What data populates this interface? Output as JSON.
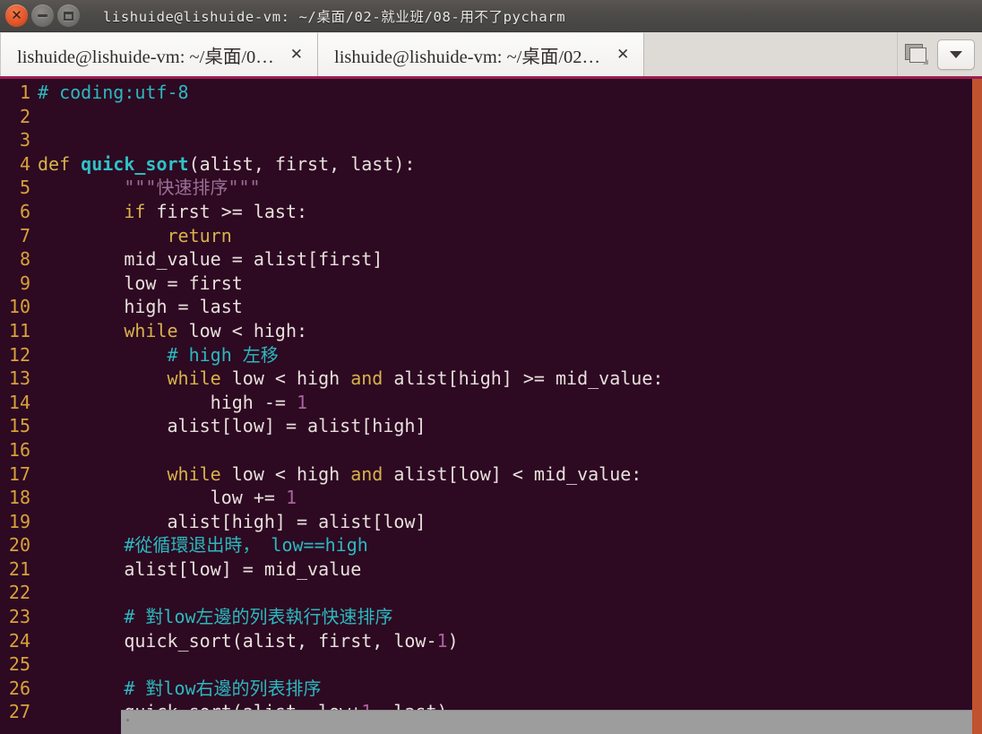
{
  "window": {
    "title": "lishuide@lishuide-vm: ~/桌面/02-就业班/08-用不了pycharm",
    "buttons": {
      "close": "×",
      "minimize": "−",
      "maximize": "□"
    }
  },
  "tabs": [
    {
      "label": "lishuide@lishuide-vm: ~/桌面/0…",
      "close": "✕",
      "active": false
    },
    {
      "label": "lishuide@lishuide-vm: ~/桌面/02…",
      "close": "✕",
      "active": true
    }
  ],
  "tabbar_controls": {
    "new_tab_icon": "new-tab-icon",
    "dropdown_icon": "chevron-down-icon"
  },
  "colors": {
    "terminal_background": "#2d0922",
    "accent_border": "#c0522f",
    "tabbar_underline": "#9c1d52",
    "line_number": "#d7a23a",
    "keyword": "#d8b24a",
    "function": "#2fc2c6",
    "comment": "#2bb9bf",
    "string": "#9c6f95",
    "number": "#a9639f",
    "plain_text": "#e8e0dc"
  },
  "editor": {
    "lines": [
      {
        "n": "1",
        "tokens": [
          {
            "t": "# coding:utf-8",
            "c": "c-com"
          }
        ]
      },
      {
        "n": "2",
        "tokens": []
      },
      {
        "n": "3",
        "tokens": []
      },
      {
        "n": "4",
        "tokens": [
          {
            "t": "def ",
            "c": "c-def"
          },
          {
            "t": "quick_sort",
            "c": "c-fn"
          },
          {
            "t": "(alist, first, last):",
            "c": "c-plain"
          }
        ]
      },
      {
        "n": "5",
        "tokens": [
          {
            "t": "        ",
            "c": "c-plain"
          },
          {
            "t": "\"\"\"快速排序\"\"\"",
            "c": "c-str"
          }
        ]
      },
      {
        "n": "6",
        "tokens": [
          {
            "t": "        ",
            "c": "c-plain"
          },
          {
            "t": "if ",
            "c": "c-def"
          },
          {
            "t": "first >= last:",
            "c": "c-plain"
          }
        ]
      },
      {
        "n": "7",
        "tokens": [
          {
            "t": "            ",
            "c": "c-plain"
          },
          {
            "t": "return",
            "c": "c-def"
          }
        ]
      },
      {
        "n": "8",
        "tokens": [
          {
            "t": "        mid_value = alist[first]",
            "c": "c-plain"
          }
        ]
      },
      {
        "n": "9",
        "tokens": [
          {
            "t": "        low = first",
            "c": "c-plain"
          }
        ]
      },
      {
        "n": "10",
        "tokens": [
          {
            "t": "        high = last",
            "c": "c-plain"
          }
        ]
      },
      {
        "n": "11",
        "tokens": [
          {
            "t": "        ",
            "c": "c-plain"
          },
          {
            "t": "while ",
            "c": "c-def"
          },
          {
            "t": "low < high:",
            "c": "c-plain"
          }
        ]
      },
      {
        "n": "12",
        "tokens": [
          {
            "t": "            ",
            "c": "c-plain"
          },
          {
            "t": "# high 左移",
            "c": "c-com"
          }
        ]
      },
      {
        "n": "13",
        "tokens": [
          {
            "t": "            ",
            "c": "c-plain"
          },
          {
            "t": "while ",
            "c": "c-def"
          },
          {
            "t": "low < high ",
            "c": "c-plain"
          },
          {
            "t": "and ",
            "c": "c-def"
          },
          {
            "t": "alist[high] >= mid_value:",
            "c": "c-plain"
          }
        ]
      },
      {
        "n": "14",
        "tokens": [
          {
            "t": "                high -= ",
            "c": "c-plain"
          },
          {
            "t": "1",
            "c": "c-num"
          }
        ]
      },
      {
        "n": "15",
        "tokens": [
          {
            "t": "            alist[low] = alist[high]",
            "c": "c-plain"
          }
        ]
      },
      {
        "n": "16",
        "tokens": []
      },
      {
        "n": "17",
        "tokens": [
          {
            "t": "            ",
            "c": "c-plain"
          },
          {
            "t": "while ",
            "c": "c-def"
          },
          {
            "t": "low < high ",
            "c": "c-plain"
          },
          {
            "t": "and ",
            "c": "c-def"
          },
          {
            "t": "alist[low] < mid_value:",
            "c": "c-plain"
          }
        ]
      },
      {
        "n": "18",
        "tokens": [
          {
            "t": "                low += ",
            "c": "c-plain"
          },
          {
            "t": "1",
            "c": "c-num"
          }
        ]
      },
      {
        "n": "19",
        "tokens": [
          {
            "t": "            alist[high] = alist[low]",
            "c": "c-plain"
          }
        ]
      },
      {
        "n": "20",
        "tokens": [
          {
            "t": "        ",
            "c": "c-plain"
          },
          {
            "t": "#從循環退出時， low==high",
            "c": "c-com"
          }
        ]
      },
      {
        "n": "21",
        "tokens": [
          {
            "t": "        alist[low] = mid_value",
            "c": "c-plain"
          }
        ]
      },
      {
        "n": "22",
        "tokens": []
      },
      {
        "n": "23",
        "tokens": [
          {
            "t": "        ",
            "c": "c-plain"
          },
          {
            "t": "# 對low左邊的列表執行快速排序",
            "c": "c-com"
          }
        ]
      },
      {
        "n": "24",
        "tokens": [
          {
            "t": "        quick_sort(alist, first, low-",
            "c": "c-plain"
          },
          {
            "t": "1",
            "c": "c-num"
          },
          {
            "t": ")",
            "c": "c-plain"
          }
        ]
      },
      {
        "n": "25",
        "tokens": []
      },
      {
        "n": "26",
        "tokens": [
          {
            "t": "        ",
            "c": "c-plain"
          },
          {
            "t": "# 對low右邊的列表排序",
            "c": "c-com"
          }
        ]
      },
      {
        "n": "27",
        "tokens": [
          {
            "t": "        quick_sort(alist, low+",
            "c": "c-plain"
          },
          {
            "t": "1",
            "c": "c-num"
          },
          {
            "t": ", last)",
            "c": "c-plain"
          }
        ]
      }
    ]
  }
}
